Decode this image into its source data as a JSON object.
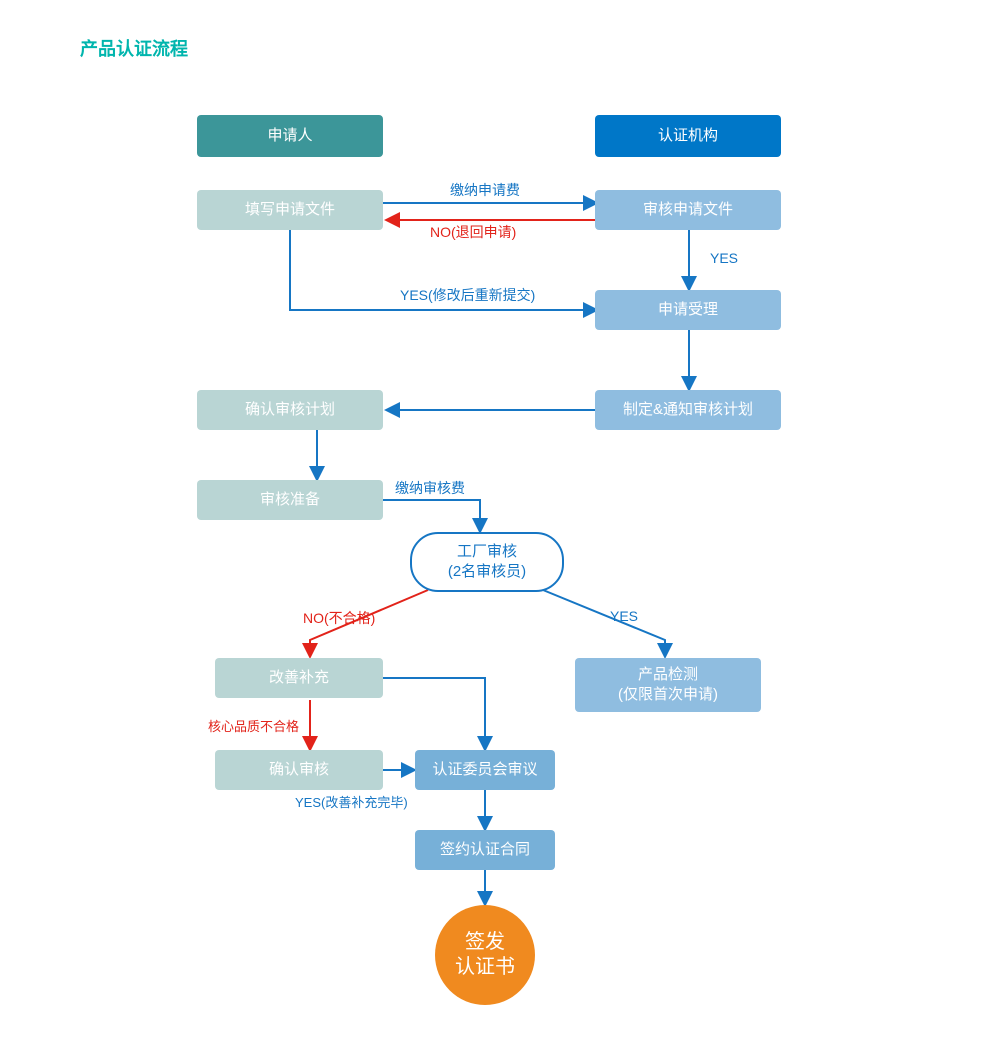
{
  "title": "产品认证流程",
  "headers": {
    "left": "申请人",
    "right": "认证机构"
  },
  "left_column": {
    "fill_app_docs": "填写申请文件",
    "confirm_plan": "确认审核计划",
    "audit_prep": "审核准备",
    "improve_supplement": "改善补充",
    "confirm_audit": "确认审核"
  },
  "right_column": {
    "review_app_docs": "审核申请文件",
    "app_accepted": "申请受理",
    "make_notify_plan": "制定&通知审核计划",
    "product_test_line1": "产品检测",
    "product_test_line2": "(仅限首次申请)"
  },
  "middle": {
    "factory_audit_line1": "工厂审核",
    "factory_audit_line2": "(2名审核员)",
    "committee_review": "认证委员会审议",
    "sign_contract": "签约认证合同",
    "issue_cert_line1": "签发",
    "issue_cert_line2": "认证书"
  },
  "labels": {
    "pay_app_fee": "缴纳申请费",
    "no_return_app": "NO(退回申请)",
    "yes_resubmit": "YES(修改后重新提交)",
    "yes_plain": "YES",
    "pay_audit_fee": "缴纳审核费",
    "no_fail": "NO(不合格)",
    "core_quality_fail": "核心品质不合格",
    "yes_improvement_done": "YES(改善补充完毕)"
  },
  "colors": {
    "blue": "#1676c4",
    "red": "#e2231a"
  }
}
